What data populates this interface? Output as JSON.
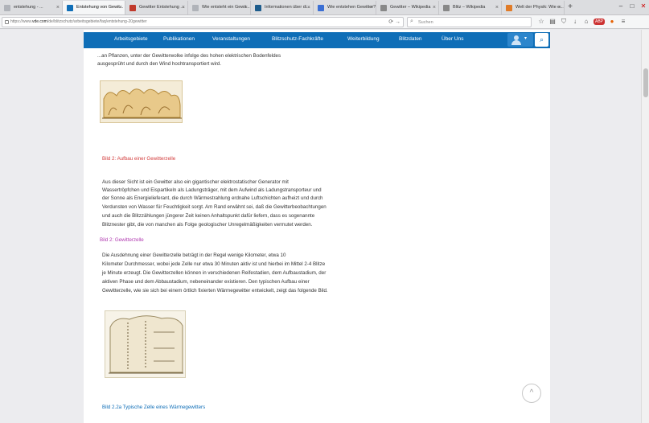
{
  "browser": {
    "tabs": [
      {
        "label": "entstehung - ..."
      },
      {
        "label": "Entstehung von Gewit...",
        "active": true
      },
      {
        "label": "Gewitter Entstehung ..."
      },
      {
        "label": "Wie entsteht ein Gewit..."
      },
      {
        "label": "Informationen über di..."
      },
      {
        "label": "Wie entstehen Gewitter?"
      },
      {
        "label": "Gewitter – Wikipedia"
      },
      {
        "label": "Blitz – Wikipedia"
      },
      {
        "label": "Welt der Physik: Wie e..."
      }
    ],
    "new_tab": "+",
    "window_buttons": {
      "minimize": "–",
      "maximize": "□",
      "close": "✕"
    },
    "url_prefix": "https://www.",
    "url_domain": "vde.com",
    "url_path": "/de/blitzschutz/arbeitsgebiete/faq/entstehung-20gewitter",
    "search_placeholder": "Suchen",
    "toolbar_icons": [
      "star-icon",
      "reader-icon",
      "shield-icon",
      "download-icon",
      "home-icon",
      "adblock-icon",
      "firefox-icon",
      "menu-icon"
    ],
    "abp_label": "ABP"
  },
  "site_nav": {
    "items": [
      "Arbeitsgebiete",
      "Publikationen",
      "Veranstaltungen",
      "Blitzschutz-Fachkräfte",
      "Weiterbildung",
      "Blitzdaten",
      "Über Uns"
    ],
    "user_caret": "▾",
    "search_icon": "⌕"
  },
  "content": {
    "intro_line1": "...an Pflanzen, unter der Gewitterwolke infolge des hohen elektrischen Bodenfeldes",
    "intro_line2": "ausgesprüht und durch den Wind hochtransportiert wird.",
    "heading1": "Bild 2: Aufbau einer Gewitterzelle",
    "para1": [
      "Aus dieser Sicht ist ein Gewitter also ein gigantischer elektrostatischer Generator mit",
      "Wassertröpfchen und Eispartikeln als Ladungsträger, mit dem Aufwind als Ladungstransporteur und",
      "der Sonne als Energielieferant, die durch Wärmestrahlung erdnahe Luftschichten aufheizt und durch",
      "Verdunsten von Wasser für Feuchtigkeit sorgt. Am Rand erwähnt sei, daß die Gewitterbeobachtungen",
      "und auch die Blitzzählungen jüngerer Zeit keinen Anhaltspunkt dafür liefern, dass es sogenannte",
      "Blitznester gibt, die von manchen als Folge geologischer Unregelmäßigkeiten vermutet werden."
    ],
    "heading2": "Bild 2: Gewitterzelle",
    "para2": [
      "Die Ausdehnung einer Gewitterzelle beträgt in der Regel wenige Kilometer, etwa 10",
      "Kilometer Durchmesser, wobei jede Zelle nur etwa 30 Minuten aktiv ist und hierbei im Mittel 2-4 Blitze",
      "je Minute erzeugt. Die Gewitterzellen können in verschiedenen Reifestadien, dem Aufbaustadium, der",
      "aktiven Phase und dem Abbaustadium, nebeneinander existieren. Den typischen Aufbau einer",
      "Gewitterzelle, wie sie sich bei einem örtlich fixierten Wärmegewitter entwickelt, zeigt das folgende Bild."
    ],
    "caption": "Bild 2.2a Typische Zelle eines Wärmegewitters",
    "scroll_top": "^"
  }
}
